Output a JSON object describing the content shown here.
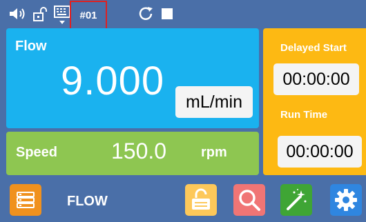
{
  "status_bar": {
    "pump_id": "#01",
    "icons": [
      "speaker-icon",
      "unlock-icon",
      "keyboard-icon",
      "refresh-icon",
      "stop-icon"
    ]
  },
  "flow": {
    "label": "Flow",
    "value": "9.000",
    "unit": "mL/min"
  },
  "speed": {
    "label": "Speed",
    "value": "150.0",
    "unit": "rpm"
  },
  "timers": {
    "delayed_start_label": "Delayed Start",
    "delayed_start_value": "00:00:00",
    "run_time_label": "Run Time",
    "run_time_value": "00:00:00"
  },
  "bottom_bar": {
    "mode_label": "FLOW",
    "buttons": [
      "menu-icon",
      "unlock-icon",
      "search-icon",
      "magic-wand-icon",
      "gear-icon"
    ]
  },
  "colors": {
    "background": "#4a6fa8",
    "flow_panel": "#1ab2ef",
    "speed_panel": "#8ec651",
    "time_panel": "#fdb913",
    "highlight_box": "#e02020",
    "menu_button": "#f0911e",
    "unlock_button": "#fdc85a",
    "search_button": "#f07575",
    "wand_button": "#3fa535",
    "gear_button": "#2f86e0"
  }
}
